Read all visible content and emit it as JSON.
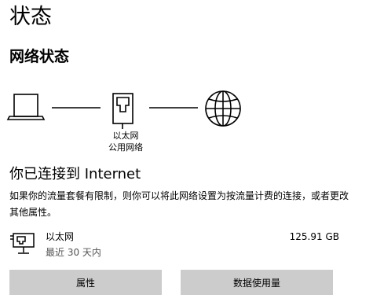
{
  "page": {
    "title": "状态"
  },
  "network_status": {
    "title": "网络状态",
    "device_icons": [
      "laptop-icon",
      "ethernet-port-icon",
      "globe-icon"
    ],
    "connection_name": "以太网",
    "network_profile": "公用网络"
  },
  "connection": {
    "heading": "你已连接到 Internet",
    "description": "如果你的流量套餐有限制，则你可以将此网络设置为按流量计费的连接，或者更改其他属性。"
  },
  "adapter": {
    "icon": "ethernet-adapter-icon",
    "name": "以太网",
    "period": "最近 30 天内",
    "usage": "125.91 GB"
  },
  "buttons": {
    "properties": "属性",
    "data_usage": "数据使用量"
  },
  "colors": {
    "button_bg": "#cccccc",
    "muted_text": "#555555"
  }
}
